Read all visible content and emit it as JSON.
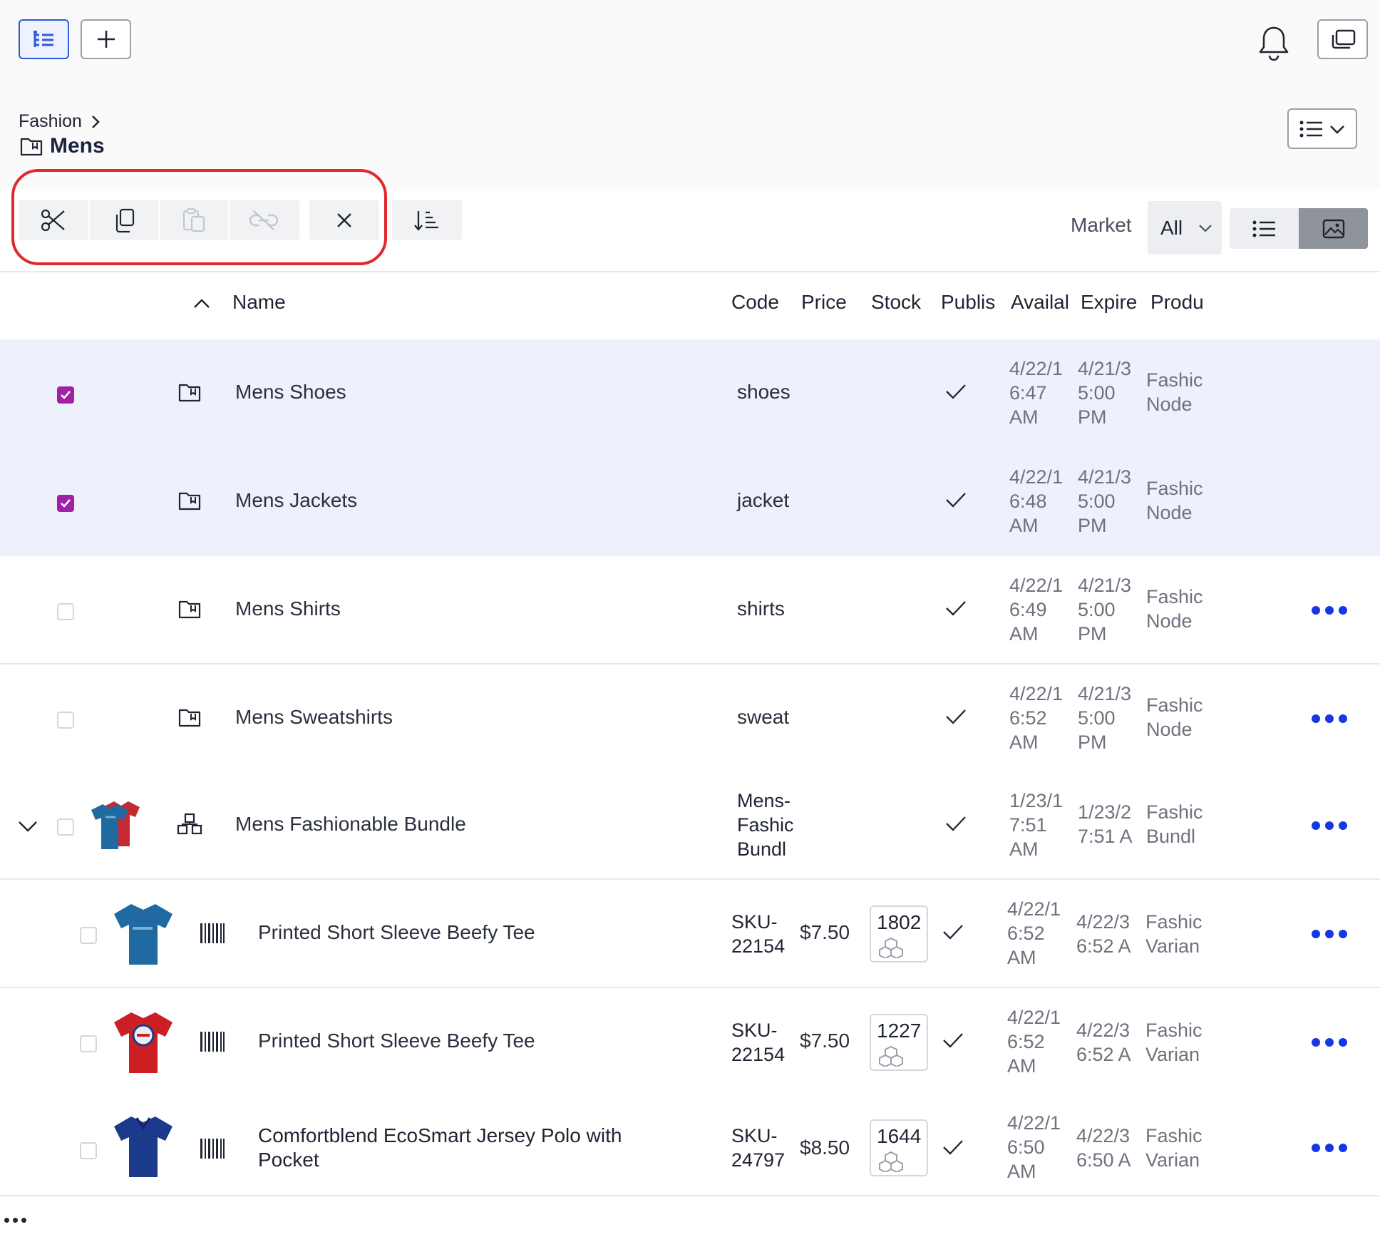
{
  "breadcrumb": {
    "parent": "Fashion",
    "current": "Mens"
  },
  "market": {
    "label": "Market",
    "value": "All"
  },
  "columns": {
    "name": "Name",
    "code": "Code",
    "price": "Price",
    "stock": "Stock",
    "published": "Publis",
    "available": "Availal",
    "expire": "Expire",
    "product": "Produ"
  },
  "rows": [
    {
      "name": "Mens Shoes",
      "code": "shoes",
      "available": [
        "4/22/1",
        "6:47",
        "AM"
      ],
      "expire": [
        "4/21/3",
        "5:00",
        "PM"
      ],
      "product": [
        "Fashic",
        "Node"
      ],
      "checked": true
    },
    {
      "name": "Mens Jackets",
      "code": "jacket",
      "available": [
        "4/22/1",
        "6:48",
        "AM"
      ],
      "expire": [
        "4/21/3",
        "5:00",
        "PM"
      ],
      "product": [
        "Fashic",
        "Node"
      ],
      "checked": true
    },
    {
      "name": "Mens Shirts",
      "code": "shirts",
      "available": [
        "4/22/1",
        "6:49",
        "AM"
      ],
      "expire": [
        "4/21/3",
        "5:00",
        "PM"
      ],
      "product": [
        "Fashic",
        "Node"
      ],
      "checked": false
    },
    {
      "name": "Mens Sweatshirts",
      "code": "sweat",
      "available": [
        "4/22/1",
        "6:52",
        "AM"
      ],
      "expire": [
        "4/21/3",
        "5:00",
        "PM"
      ],
      "product": [
        "Fashic",
        "Node"
      ],
      "checked": false
    },
    {
      "name": "Mens Fashionable Bundle",
      "code": [
        "Mens-",
        "Fashic",
        "Bundl"
      ],
      "available": [
        "1/23/1",
        "7:51",
        "AM"
      ],
      "expire": [
        "1/23/2",
        "7:51 A"
      ],
      "product": [
        "Fashic",
        "Bundl"
      ],
      "checked": false
    },
    {
      "name": "Printed Short Sleeve Beefy Tee",
      "code": [
        "SKU-",
        "22154"
      ],
      "price": "$7.50",
      "stock": "1802",
      "available": [
        "4/22/1",
        "6:52",
        "AM"
      ],
      "expire": [
        "4/22/3",
        "6:52 A"
      ],
      "product": [
        "Fashic",
        "Varian"
      ],
      "checked": false,
      "thumb_color": "#1f6aa0"
    },
    {
      "name": "Printed Short Sleeve Beefy Tee",
      "code": [
        "SKU-",
        "22154"
      ],
      "price": "$7.50",
      "stock": "1227",
      "available": [
        "4/22/1",
        "6:52",
        "AM"
      ],
      "expire": [
        "4/22/3",
        "6:52 A"
      ],
      "product": [
        "Fashic",
        "Varian"
      ],
      "checked": false,
      "thumb_color": "#cc1f24"
    },
    {
      "name": [
        "Comfortblend EcoSmart Jersey Polo with",
        "Pocket"
      ],
      "code": [
        "SKU-",
        "24797"
      ],
      "price": "$8.50",
      "stock": "1644",
      "available": [
        "4/22/1",
        "6:50",
        "AM"
      ],
      "expire": [
        "4/22/3",
        "6:50 A"
      ],
      "product": [
        "Fashic",
        "Varian"
      ],
      "checked": false,
      "thumb_color": "#1c3a8c"
    }
  ],
  "icons": {
    "tree": "tree-view-icon",
    "add": "plus-icon",
    "bell": "bell-icon",
    "window": "windows-icon",
    "cut": "scissors-icon",
    "copy": "copy-icon",
    "paste": "paste-icon",
    "unlink": "unlink-icon",
    "clear": "close-icon",
    "sort": "sort-icon"
  },
  "colors": {
    "accent": "#2f5bd3",
    "checkbox": "#a020a8",
    "more": "#1737e6",
    "highlight": "#e0282f",
    "selected_row": "#eef1fc"
  }
}
